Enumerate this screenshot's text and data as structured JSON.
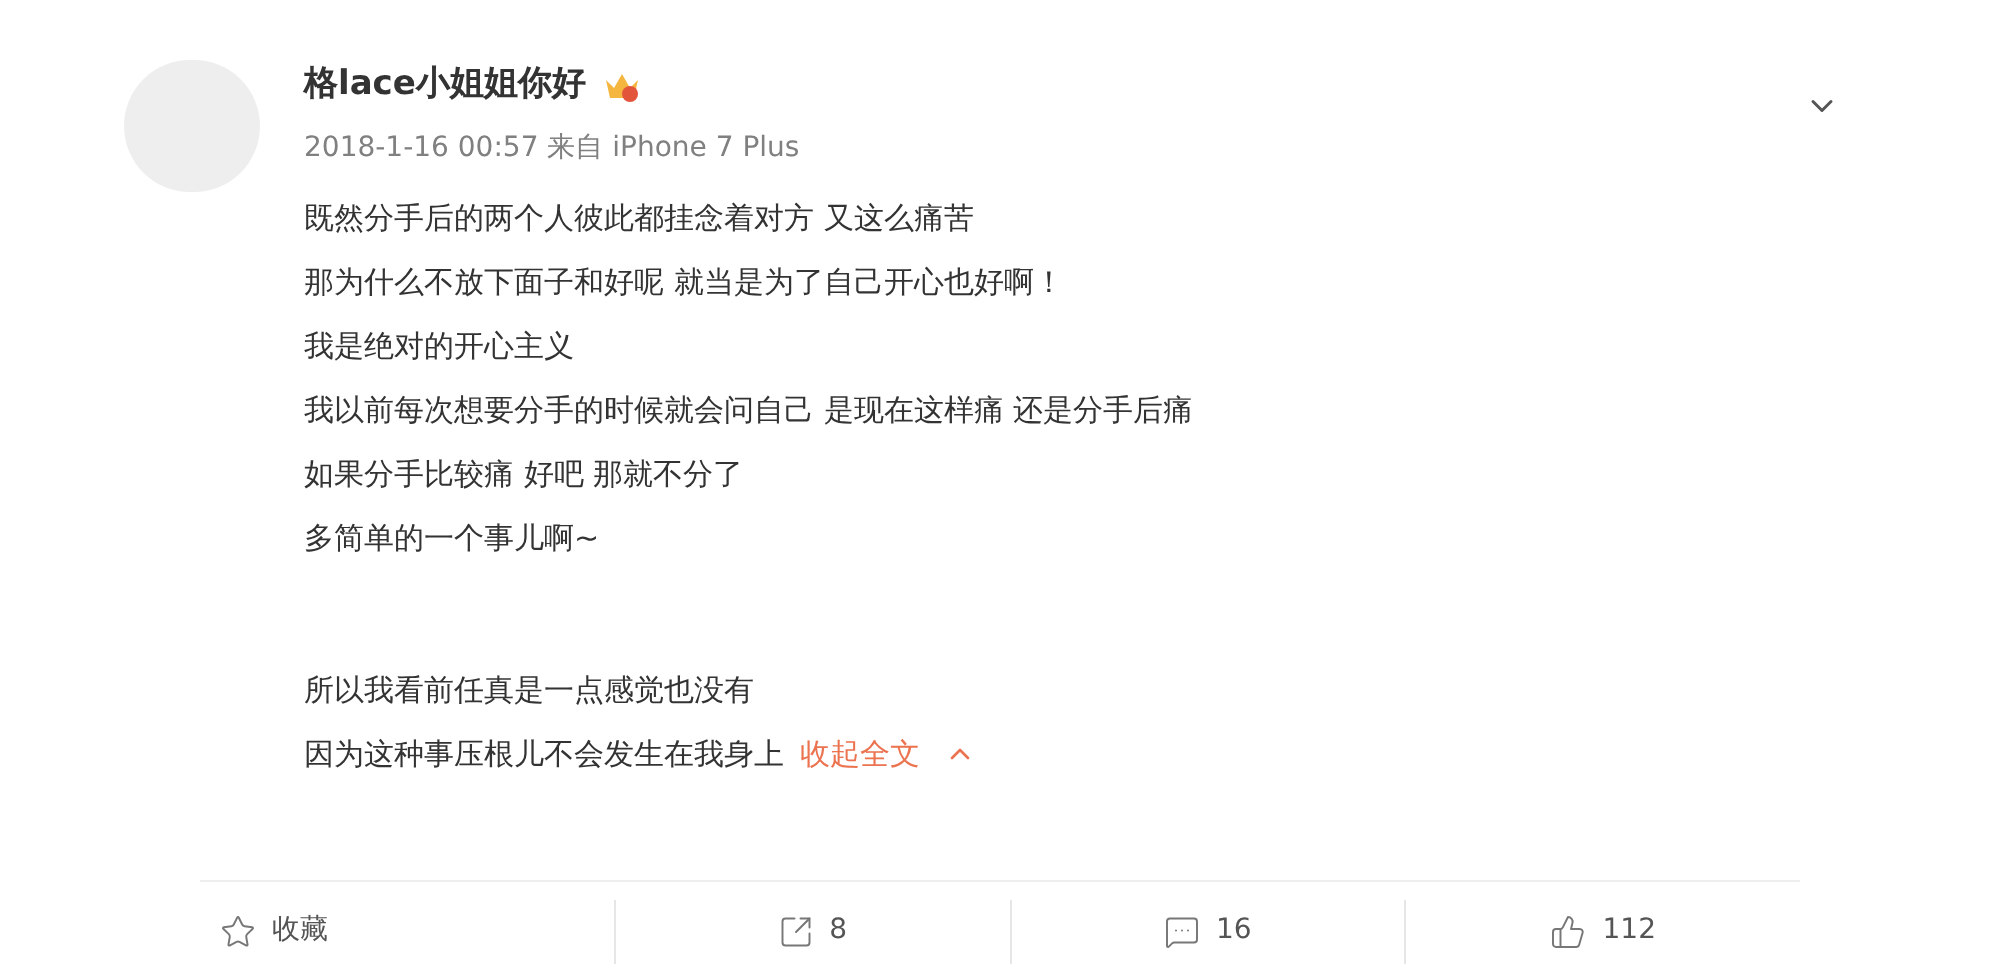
{
  "post": {
    "author": "格lace小姐姐你好",
    "meta": "2018-1-16 00:57 来自 iPhone 7 Plus",
    "paragraphs": [
      [
        "既然分手后的两个人彼此都挂念着对方 又这么痛苦",
        "那为什么不放下面子和好呢 就当是为了自己开心也好啊！",
        "我是绝对的开心主义",
        "我以前每次想要分手的时候就会问自己 是现在这样痛 还是分手后痛",
        "如果分手比较痛 好吧 那就不分了",
        "多简单的一个事儿啊~"
      ],
      [
        "所以我看前任真是一点感觉也没有",
        "因为这种事压根儿不会发生在我身上"
      ]
    ],
    "collapse_link": "收起全文"
  },
  "actions": [
    {
      "kind": "favorite",
      "label": "收藏"
    },
    {
      "kind": "repost",
      "label": "8"
    },
    {
      "kind": "comment",
      "label": "16"
    },
    {
      "kind": "like",
      "label": "112"
    }
  ]
}
